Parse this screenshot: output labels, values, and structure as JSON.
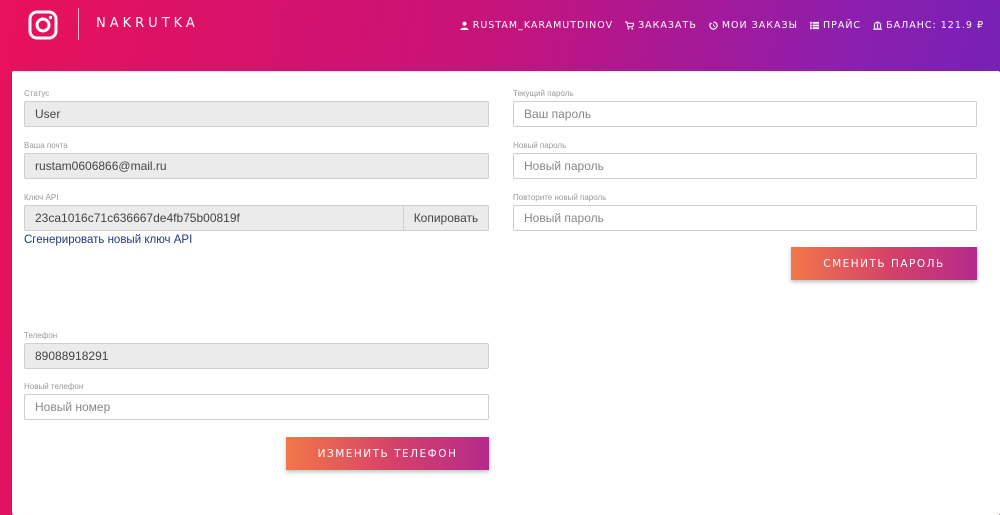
{
  "header": {
    "brand": "NAKRUTKA",
    "nav": [
      {
        "icon": "user-icon",
        "label": "RUSTAM_KARAMUTDINOV"
      },
      {
        "icon": "cart-icon",
        "label": "ЗАКАЗАТЬ"
      },
      {
        "icon": "history-icon",
        "label": "МОИ ЗАКАЗЫ"
      },
      {
        "icon": "list-icon",
        "label": "ПРАЙС"
      },
      {
        "icon": "bank-icon",
        "label": "БАЛАНС: 121.9 ₽"
      }
    ]
  },
  "profile": {
    "status_label": "Статус",
    "status_value": "User",
    "email_label": "Ваша почта",
    "email_value": "rustam0606866@mail.ru",
    "api_label": "Ключ API",
    "api_value": "23ca1016c71c636667de4fb75b00819f",
    "copy_label": "Копировать",
    "generate_link": "Сгенерировать новый ключ API",
    "phone_label": "Телефон",
    "phone_value": "89088918291",
    "new_phone_label": "Новый телефон",
    "new_phone_placeholder": "Новый номер",
    "change_phone_button": "ИЗМЕНИТЬ ТЕЛЕФОН"
  },
  "password": {
    "current_label": "Текущий пароль",
    "current_placeholder": "Ваш пароль",
    "new_label": "Новый пароль",
    "new_placeholder": "Новый пароль",
    "repeat_label": "Повторите новый пароль",
    "repeat_placeholder": "Новый пароль",
    "change_button": "СМЕНИТЬ ПАРОЛЬ"
  }
}
